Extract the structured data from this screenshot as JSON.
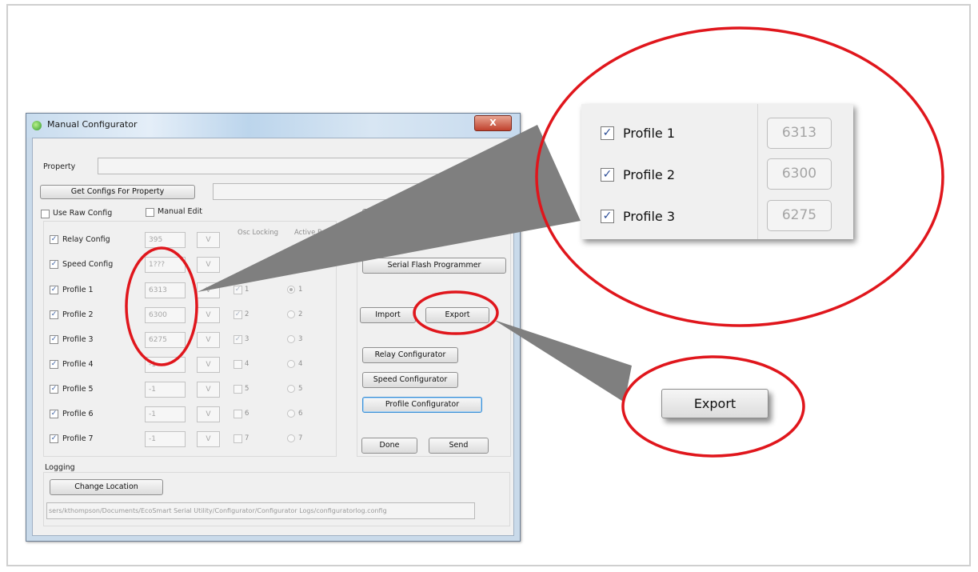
{
  "window": {
    "title": "Manual Configurator",
    "close_label": "X"
  },
  "property": {
    "label": "Property",
    "value": ""
  },
  "get_configs_button": "Get Configs For Property",
  "use_raw_config_label": "Use Raw Config",
  "manual_edit_label": "Manual Edit",
  "column_headers": {
    "osc_locking": "Osc Locking",
    "active_profile": "Active Profile"
  },
  "config_rows": [
    {
      "label": "Relay Config",
      "checked": true,
      "value": "395",
      "v": "V"
    },
    {
      "label": "Speed Config",
      "checked": true,
      "value": "1???",
      "v": "V"
    }
  ],
  "profile_rows": [
    {
      "label": "Profile 1",
      "checked": true,
      "value": "6313",
      "v": "V",
      "osc": "1",
      "osc_checked": true,
      "active": "1",
      "active_selected": true
    },
    {
      "label": "Profile 2",
      "checked": true,
      "value": "6300",
      "v": "V",
      "osc": "2",
      "osc_checked": true,
      "active": "2",
      "active_selected": false
    },
    {
      "label": "Profile 3",
      "checked": true,
      "value": "6275",
      "v": "V",
      "osc": "3",
      "osc_checked": true,
      "active": "3",
      "active_selected": false
    },
    {
      "label": "Profile 4",
      "checked": true,
      "value": "-1",
      "v": "V",
      "osc": "4",
      "osc_checked": false,
      "active": "4",
      "active_selected": false
    },
    {
      "label": "Profile 5",
      "checked": true,
      "value": "-1",
      "v": "V",
      "osc": "5",
      "osc_checked": false,
      "active": "5",
      "active_selected": false
    },
    {
      "label": "Profile 6",
      "checked": true,
      "value": "-1",
      "v": "V",
      "osc": "6",
      "osc_checked": false,
      "active": "6",
      "active_selected": false
    },
    {
      "label": "Profile 7",
      "checked": true,
      "value": "-1",
      "v": "V",
      "osc": "7",
      "osc_checked": false,
      "active": "7",
      "active_selected": false
    }
  ],
  "buttons": {
    "serial_flash": "Serial Flash Programmer",
    "import": "Import",
    "export": "Export",
    "relay_configurator": "Relay Configurator",
    "speed_configurator": "Speed Configurator",
    "profile_configurator": "Profile Configurator",
    "done": "Done",
    "send": "Send"
  },
  "logging": {
    "label": "Logging",
    "change_location": "Change Location",
    "path": "sers/kthompson/Documents/EcoSmart Serial Utility/Configurator/Configurator Logs/configuratorlog.config"
  },
  "zoom_callout": {
    "rows": [
      {
        "label": "Profile 1",
        "value": "6313"
      },
      {
        "label": "Profile 2",
        "value": "6300"
      },
      {
        "label": "Profile 3",
        "value": "6275"
      }
    ],
    "export_label": "Export"
  },
  "colors": {
    "highlight_circle": "#e0161c",
    "pointer": "#7f7f7f",
    "title_bar": "#c8dcee"
  },
  "icons": {
    "check": "✓",
    "close": "X"
  }
}
